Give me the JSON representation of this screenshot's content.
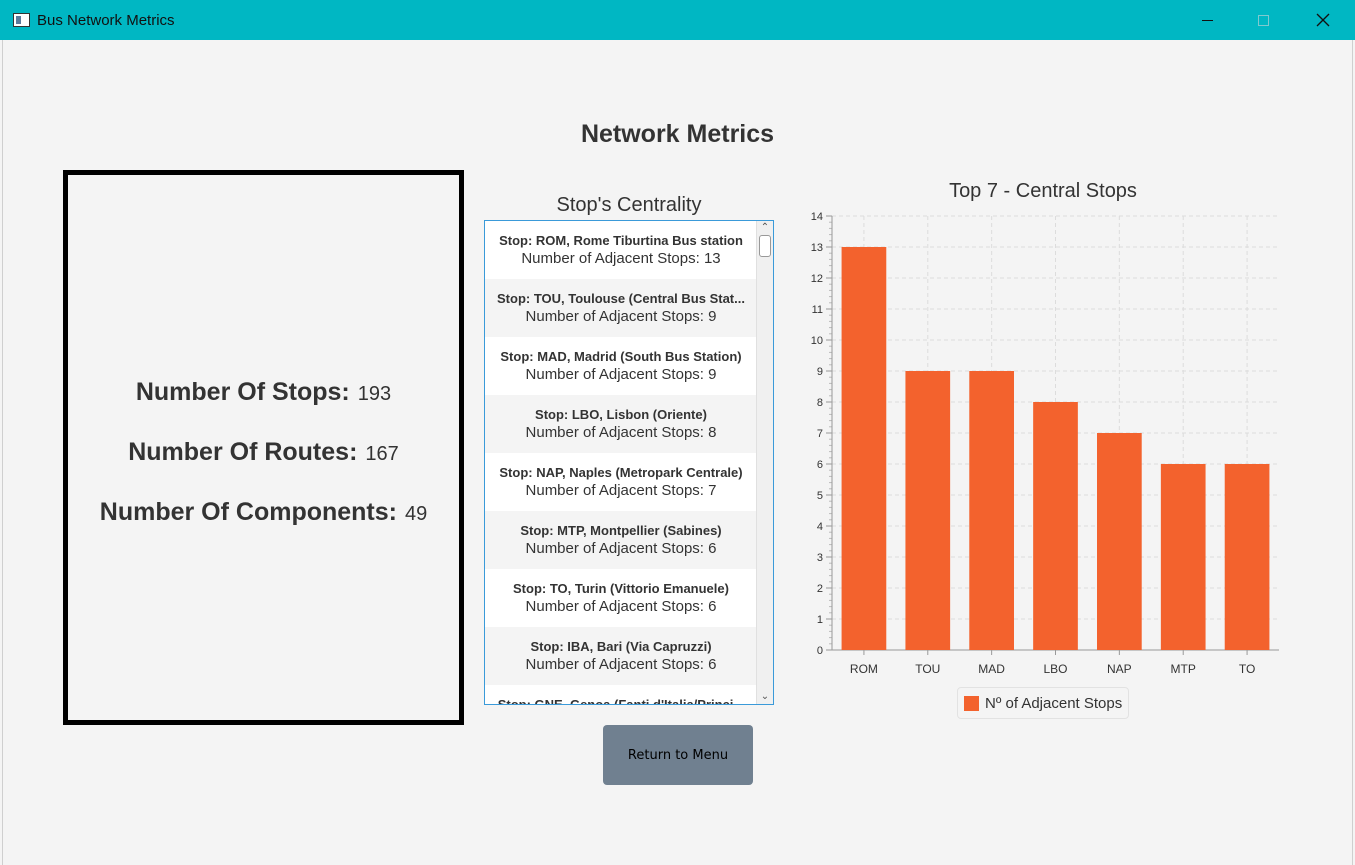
{
  "window": {
    "title": "Bus Network Metrics"
  },
  "page": {
    "title": "Network Metrics"
  },
  "metrics": {
    "stops": {
      "label": "Number Of Stops:",
      "value": "193"
    },
    "routes": {
      "label": "Number Of Routes:",
      "value": "167"
    },
    "components": {
      "label": "Number Of Components:",
      "value": "49"
    }
  },
  "centrality": {
    "title": "Stop's Centrality",
    "items": [
      {
        "stop": "Stop: ROM, Rome Tiburtina Bus station",
        "adjacent": "Number of Adjacent Stops: 13"
      },
      {
        "stop": "Stop: TOU, Toulouse (Central Bus Stat...",
        "adjacent": "Number of Adjacent Stops: 9"
      },
      {
        "stop": "Stop: MAD, Madrid (South Bus Station)",
        "adjacent": "Number of Adjacent Stops: 9"
      },
      {
        "stop": "Stop: LBO, Lisbon (Oriente)",
        "adjacent": "Number of Adjacent Stops: 8"
      },
      {
        "stop": "Stop: NAP, Naples (Metropark Centrale)",
        "adjacent": "Number of Adjacent Stops: 7"
      },
      {
        "stop": "Stop: MTP, Montpellier (Sabines)",
        "adjacent": "Number of Adjacent Stops: 6"
      },
      {
        "stop": "Stop: TO, Turin (Vittorio Emanuele)",
        "adjacent": "Number of Adjacent Stops: 6"
      },
      {
        "stop": "Stop: IBA, Bari (Via Capruzzi)",
        "adjacent": "Number of Adjacent Stops: 6"
      },
      {
        "stop": "Stop: GNE, Genoa (Fanti d'Italia/Princi...",
        "adjacent": ""
      }
    ]
  },
  "buttons": {
    "return_menu": "Return to Menu"
  },
  "colors": {
    "bar": "#f3622d",
    "titlebar": "#00b7c3",
    "button": "#708090"
  },
  "chart_data": {
    "type": "bar",
    "title": "Top 7 - Central Stops",
    "categories": [
      "ROM",
      "TOU",
      "MAD",
      "LBO",
      "NAP",
      "MTP",
      "TO"
    ],
    "series": [
      {
        "name": "Nº of Adjacent Stops",
        "values": [
          13,
          9,
          9,
          8,
          7,
          6,
          6
        ]
      }
    ],
    "ylim": [
      0,
      14
    ],
    "ytick_step": 1,
    "grid": true,
    "legend": "bottom"
  }
}
